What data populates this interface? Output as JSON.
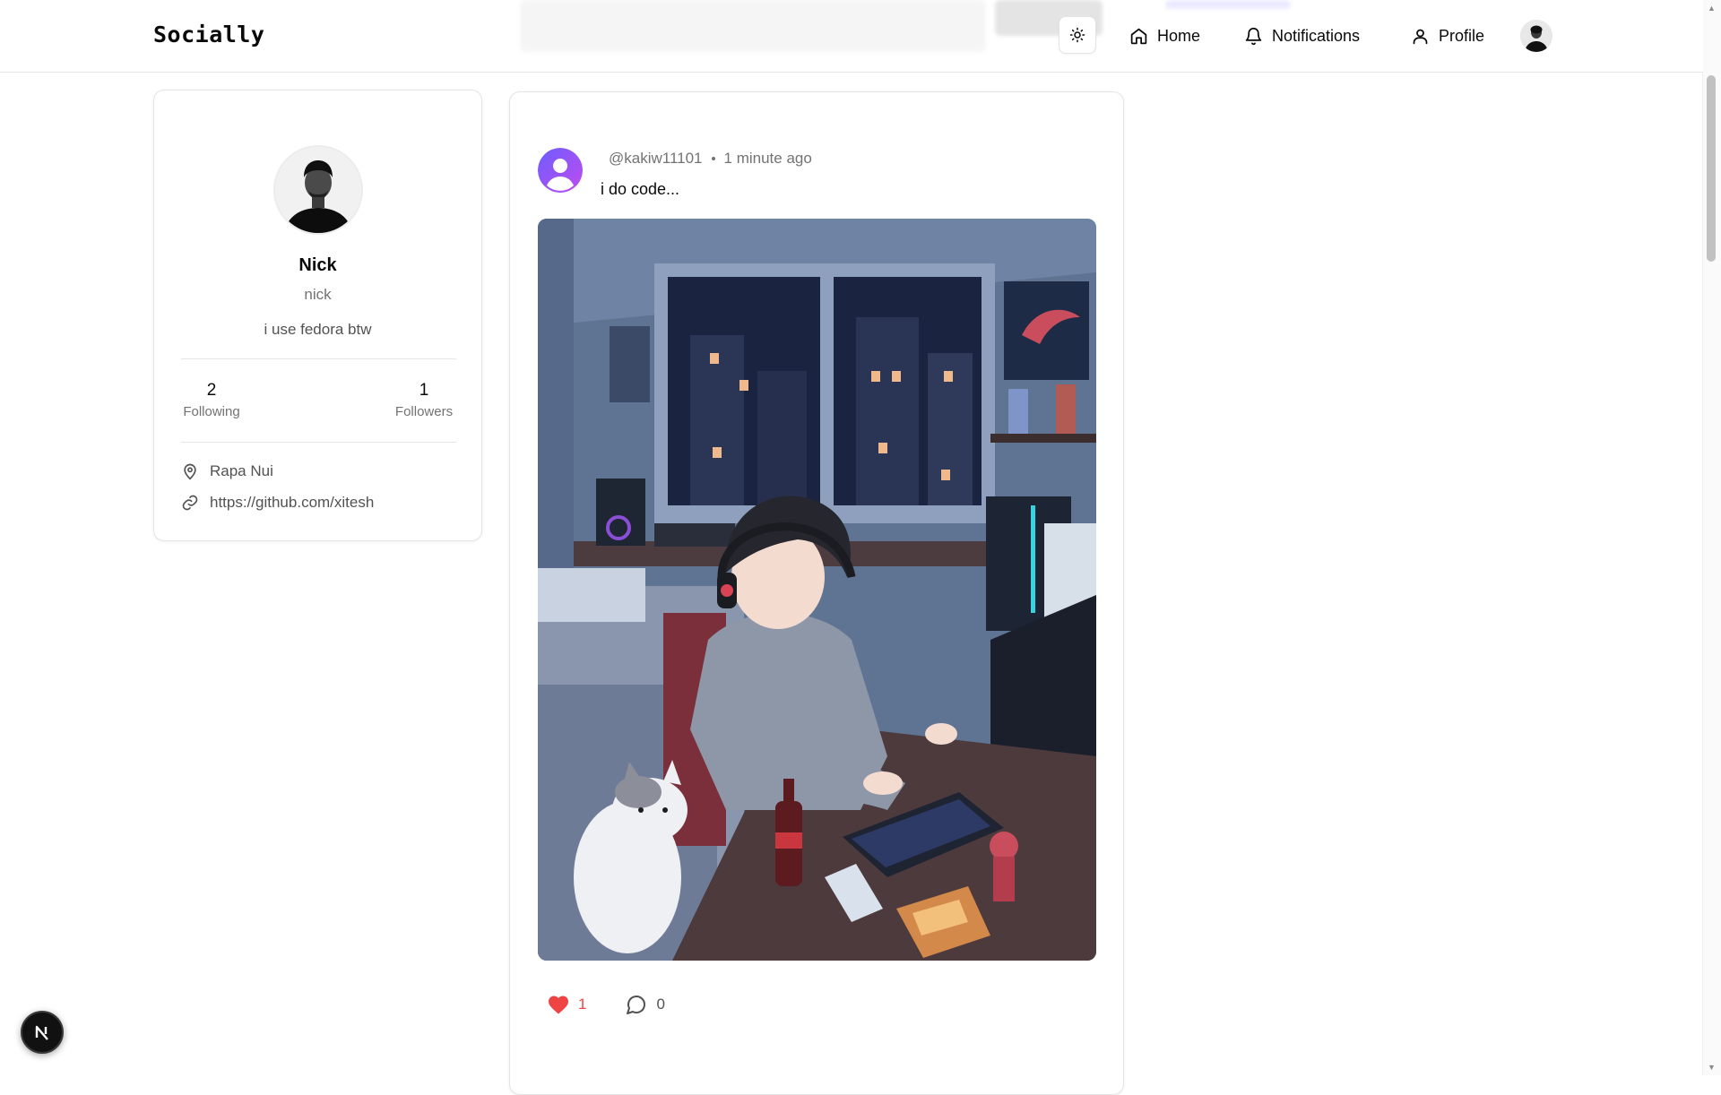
{
  "header": {
    "brand": "Socially",
    "nav": [
      {
        "label": "Home",
        "icon": "home-icon"
      },
      {
        "label": "Notifications",
        "icon": "bell-icon"
      },
      {
        "label": "Profile",
        "icon": "user-icon"
      }
    ],
    "theme_icon": "sun-icon"
  },
  "profile": {
    "name": "Nick",
    "username": "nick",
    "bio": "i use fedora btw",
    "following_count": "2",
    "following_label": "Following",
    "followers_count": "1",
    "followers_label": "Followers",
    "location": "Rapa Nui",
    "website": "https://github.com/xitesh"
  },
  "post": {
    "author_handle": "@kakiw11101",
    "time": "1 minute ago",
    "content": "i do code...",
    "image_alt": "pixel art of a person coding at a desk with a cat on a rainy night",
    "likes": "1",
    "comments": "0"
  },
  "colors": {
    "like": "#ef4444",
    "avatar_gradient_start": "#6d5dfc",
    "avatar_gradient_end": "#c04cf0",
    "border": "#e4e4e7"
  },
  "badge": {
    "label": "N"
  }
}
